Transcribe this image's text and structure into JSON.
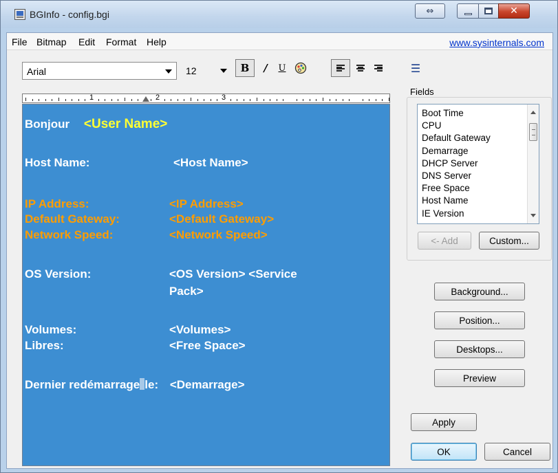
{
  "window": {
    "title": "BGInfo - config.bgi"
  },
  "menu": {
    "items": [
      "File",
      "Bitmap",
      "Edit",
      "Format",
      "Help"
    ],
    "link": "www.sysinternals.com"
  },
  "toolbar": {
    "font": "Arial",
    "size": "12"
  },
  "ruler": {
    "numbers": [
      "1",
      "2",
      "3"
    ]
  },
  "editor": {
    "greeting": "Bonjour",
    "user_name": "<User Name>",
    "host_label": "Host Name:",
    "host_value": "<Host Name>",
    "ip_label": "IP Address:",
    "ip_value": "<IP Address>",
    "gw_label": "Default Gateway:",
    "gw_value": "<Default Gateway>",
    "speed_label": "Network Speed:",
    "speed_value": "<Network Speed>",
    "os_label": "OS Version:",
    "os_value_line1": "<OS Version> <Service",
    "os_value_line2": "Pack>",
    "volumes_label": "Volumes:",
    "volumes_value": "<Volumes>",
    "free_label": "Libres:",
    "free_value": "<Free Space>",
    "reboot_label_a": "Dernier redémarrage",
    "reboot_label_b": "le:",
    "reboot_value": "<Demarrage>",
    "colors": {
      "background": "#3d8ed2",
      "text": "#ffffff",
      "highlight": "#ffff33",
      "network": "#ff9d00"
    }
  },
  "fields": {
    "title": "Fields",
    "items": [
      "Boot Time",
      "CPU",
      "Default Gateway",
      "Demarrage",
      "DHCP Server",
      "DNS Server",
      "Free Space",
      "Host Name",
      "IE Version"
    ]
  },
  "buttons": {
    "add": "<- Add",
    "custom": "Custom...",
    "background": "Background...",
    "position": "Position...",
    "desktops": "Desktops...",
    "preview": "Preview",
    "apply": "Apply",
    "ok": "OK",
    "cancel": "Cancel"
  }
}
